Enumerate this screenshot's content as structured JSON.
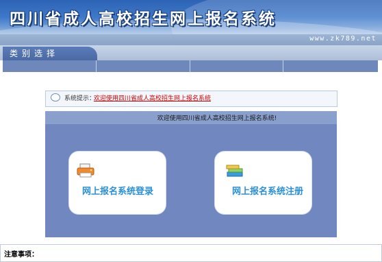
{
  "header": {
    "title": "四川省成人高校招生网上报名系统",
    "url": "www.zk789.net"
  },
  "category": {
    "label": "类别选择"
  },
  "notice": {
    "label": "系统提示：",
    "message": "欢迎使用四川省成人高校招生网上报名系统"
  },
  "welcome": {
    "text": "欢迎使用四川省成人高校招生网上报名系统!"
  },
  "cards": {
    "login_label": "网上报名系统登录",
    "register_label": "网上报名系统注册"
  },
  "footer": {
    "attention_label": "注意事项："
  },
  "colors": {
    "header_blue": "#3e79c9",
    "panel_blue": "#7087c0",
    "link_red": "#cc0000",
    "card_text": "#2a8fd6"
  },
  "icons": [
    "printer-icon",
    "books-icon",
    "notice-bubble-icon"
  ]
}
